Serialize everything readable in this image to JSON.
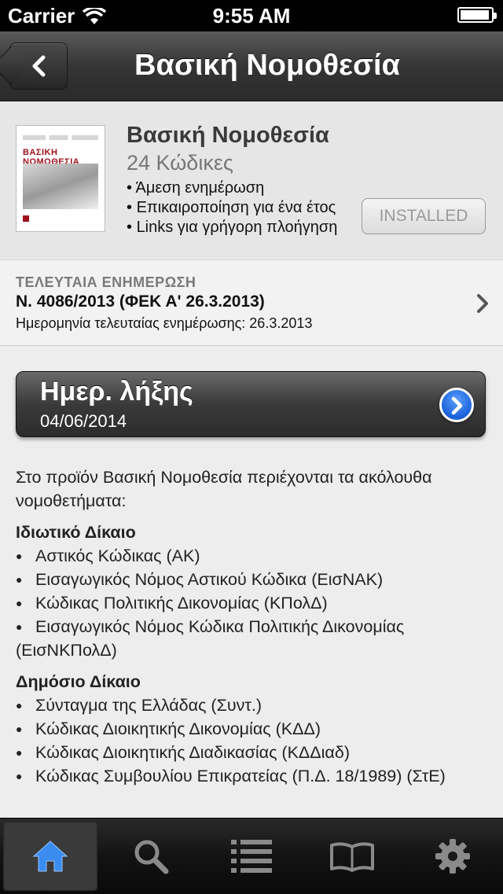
{
  "status_bar": {
    "carrier": "Carrier",
    "time": "9:55 AM"
  },
  "nav": {
    "title": "Βασική Νομοθεσία",
    "back_icon": "chevron-left-icon"
  },
  "product": {
    "cover_title": "ΒΑΣΙΚΗ ΝΟΜΟΘΕΣΙΑ",
    "title": "Βασική Νομοθεσία",
    "subtitle": "24 Κώδικες",
    "features": [
      "Άμεση ενημέρωση",
      "Επικαιροποίηση για ένα έτος",
      "Links για γρήγορη πλοήγηση"
    ],
    "button_label": "INSTALLED"
  },
  "last_update": {
    "heading": "ΤΕΛΕΥΤΑΙΑ ΕΝΗΜΕΡΩΣΗ",
    "law": "Ν. 4086/2013 (ΦΕΚ Α' 26.3.2013)",
    "date_text": "Ημερομηνία τελευταίας ενημέρωσης: 26.3.2013"
  },
  "expiry": {
    "label": "Ημερ. λήξης",
    "date": "04/06/2014"
  },
  "content": {
    "intro": "Στο προϊόν Βασική Νομοθεσία περιέχονται τα ακόλουθα νομοθετήματα:",
    "sections": [
      {
        "heading": "Ιδιωτικό Δίκαιο",
        "items": [
          "Αστικός Κώδικας (ΑΚ)",
          "Εισαγωγικός Νόμος Αστικού Κώδικα (ΕισΝΑΚ)",
          "Κώδικας Πολιτικής Δικονομίας (ΚΠολΔ)",
          "Εισαγωγικός Νόμος Κώδικα Πολιτικής Δικονομίας (ΕισΝΚΠολΔ)"
        ]
      },
      {
        "heading": "Δημόσιο Δίκαιο",
        "items": [
          "Σύνταγμα της Ελλάδας (Συντ.)",
          "Κώδικας Διοικητικής Δικονομίας (ΚΔΔ)",
          "Κώδικας Διοικητικής Διαδικασίας (ΚΔΔιαδ)",
          "Κώδικας Συμβουλίου Επικρατείας (Π.Δ. 18/1989) (ΣτΕ)"
        ]
      }
    ]
  },
  "tabbar": {
    "tabs": [
      {
        "icon": "home-icon",
        "active": true
      },
      {
        "icon": "search-icon",
        "active": false
      },
      {
        "icon": "list-icon",
        "active": false
      },
      {
        "icon": "book-icon",
        "active": false
      },
      {
        "icon": "gear-icon",
        "active": false
      }
    ],
    "active_color": "#3a8cf0"
  }
}
